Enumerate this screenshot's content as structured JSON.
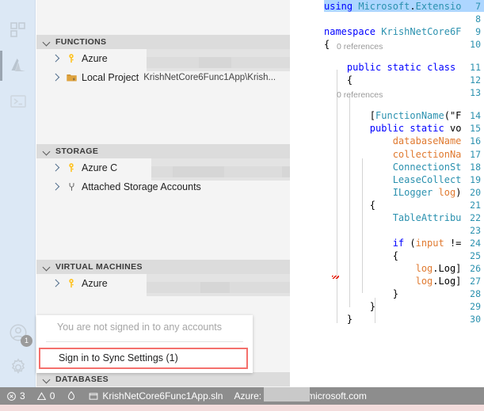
{
  "activity_bar": {
    "icons": [
      {
        "name": "extensions-icon",
        "title": "Extensions"
      },
      {
        "name": "azure-icon",
        "title": "Azure",
        "active": true
      },
      {
        "name": "terminal-powershell-icon",
        "title": "PowerShell"
      }
    ],
    "bottom_icons": [
      {
        "name": "account-icon",
        "title": "Accounts",
        "badge": "1"
      },
      {
        "name": "gear-icon",
        "title": "Manage"
      }
    ]
  },
  "explorer": {
    "sections": [
      {
        "id": "functions",
        "title": "FUNCTIONS",
        "rows": [
          {
            "icon": "key-icon",
            "label": "Azure",
            "sub": "",
            "redacted": true
          },
          {
            "icon": "local-project-icon",
            "label": "Local Project",
            "sub": "KrishNetCore6Func1App\\Krish...",
            "redacted": false
          }
        ]
      },
      {
        "id": "storage",
        "title": "STORAGE",
        "rows": [
          {
            "icon": "key-icon",
            "label": "Azure C",
            "sub": "",
            "redacted": true
          },
          {
            "icon": "plug-icon",
            "label": "Attached Storage Accounts",
            "sub": "",
            "redacted": false
          }
        ]
      },
      {
        "id": "virtual-machines",
        "title": "VIRTUAL MACHINES",
        "rows": [
          {
            "icon": "key-icon",
            "label": "Azure",
            "sub": "",
            "redacted": true
          }
        ]
      },
      {
        "id": "databases",
        "title": "DATABASES",
        "rows": []
      }
    ]
  },
  "account_flyout": {
    "message": "You are not signed in to any accounts",
    "sign_in_label": "Sign in to Sync Settings (1)",
    "highlight_color": "#f4706c"
  },
  "editor": {
    "first_line_number": 7,
    "lines": [
      {
        "n": 7,
        "text": "using Microsoft.Extensio",
        "selected": true
      },
      {
        "n": 8,
        "text": ""
      },
      {
        "n": 9,
        "text": "namespace KrishNetCore6F"
      },
      {
        "n": 10,
        "text": "{"
      },
      {
        "n": 11,
        "text": "    public static class ",
        "reference": "0 references"
      },
      {
        "n": 12,
        "text": "    {"
      },
      {
        "n": 13,
        "text": ""
      },
      {
        "n": 14,
        "text": "        [FunctionName(\"F",
        "reference": "0 references"
      },
      {
        "n": 15,
        "text": "        public static vo"
      },
      {
        "n": 16,
        "text": "            databaseName"
      },
      {
        "n": 17,
        "text": "            collectionNa"
      },
      {
        "n": 18,
        "text": "            ConnectionSt"
      },
      {
        "n": 19,
        "text": "            LeaseCollect"
      },
      {
        "n": 20,
        "text": "            ILogger log)"
      },
      {
        "n": 21,
        "text": "        {"
      },
      {
        "n": 22,
        "text": "            TableAttribu"
      },
      {
        "n": 23,
        "text": ""
      },
      {
        "n": 24,
        "text": "            if (input !="
      },
      {
        "n": 25,
        "text": "            {"
      },
      {
        "n": 26,
        "text": "                log.Log]"
      },
      {
        "n": 27,
        "text": "                log.Log]"
      },
      {
        "n": 28,
        "text": "            }"
      },
      {
        "n": 29,
        "text": "        }"
      },
      {
        "n": 30,
        "text": "    }"
      }
    ],
    "reference_label": "0 references"
  },
  "status_bar": {
    "errors_icon": "error-circle-icon",
    "errors_count": "3",
    "warnings_icon": "warning-triangle-icon",
    "warnings_count": "0",
    "live_share_icon": "live-share-icon",
    "solution_icon": "solution-icon",
    "solution_name": "KrishNetCore6Func1App.sln",
    "azure_label": "Azure:",
    "azure_account_suffix": "microsoft.com"
  }
}
